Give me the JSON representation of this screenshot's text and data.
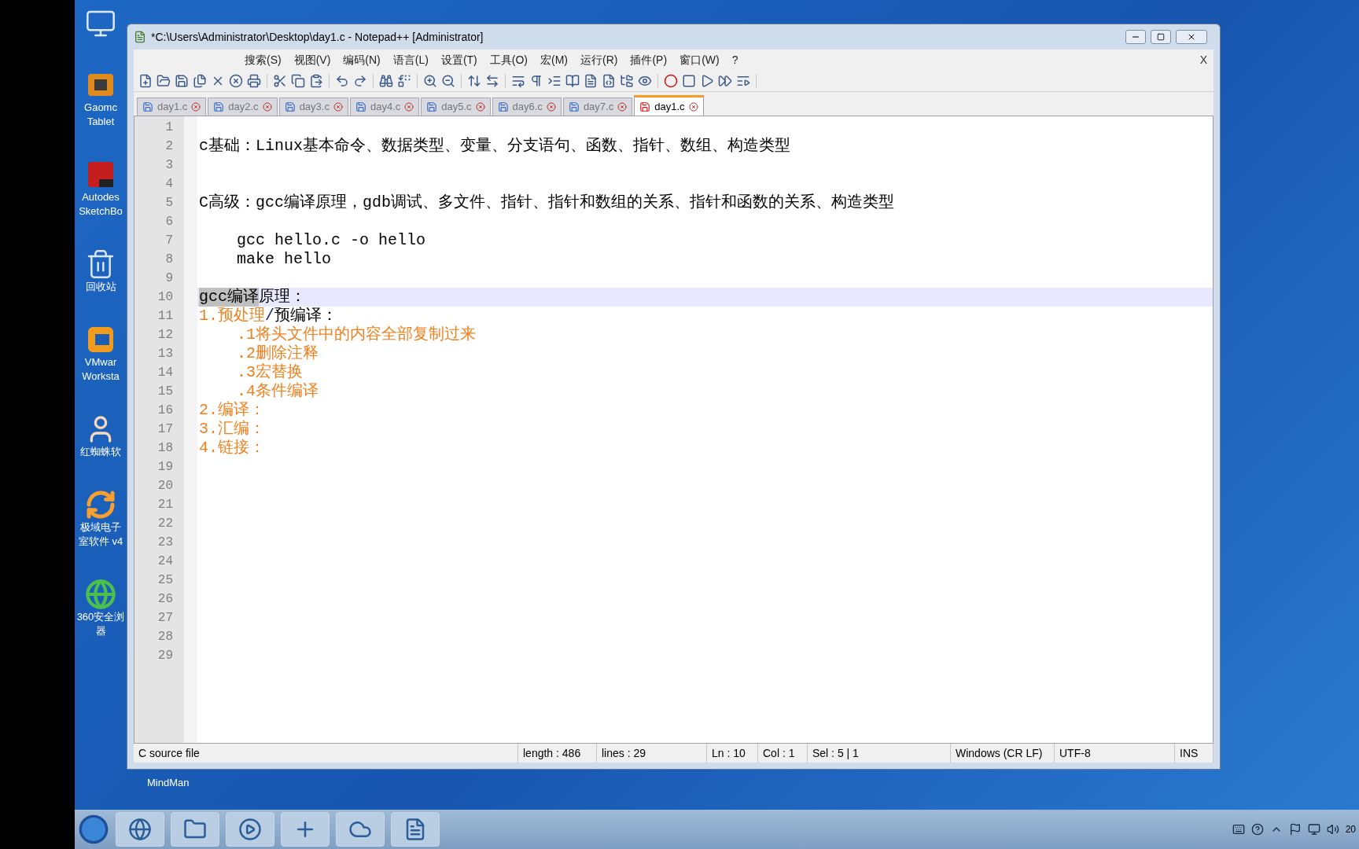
{
  "desktop": {
    "icons": [
      {
        "kind": "computer"
      },
      {
        "kind": "tablet",
        "lines": [
          "Gaomc",
          "Tablet"
        ]
      },
      {
        "kind": "sketch",
        "lines": [
          "Autodes",
          "SketchBo"
        ]
      },
      {
        "kind": "bin",
        "lines": [
          "回收站"
        ]
      },
      {
        "kind": "vm",
        "lines": [
          "VMwar",
          "Worksta"
        ]
      },
      {
        "kind": "person",
        "lines": [
          "红蜘蛛软"
        ]
      },
      {
        "kind": "sync",
        "lines": [
          "极域电子",
          "室软件 v4"
        ]
      },
      {
        "kind": "browser",
        "lines": [
          "360安全浏",
          "器"
        ]
      }
    ],
    "lower_label": "MindMan"
  },
  "window": {
    "title": "*C:\\Users\\Administrator\\Desktop\\day1.c - Notepad++ [Administrator]",
    "menu": [
      "搜索(S)",
      "视图(V)",
      "编码(N)",
      "语言(L)",
      "设置(T)",
      "工具(O)",
      "宏(M)",
      "运行(R)",
      "插件(P)",
      "窗口(W)",
      "?"
    ],
    "close_document": "X",
    "tabs": [
      {
        "label": "day1.c",
        "selected": false,
        "modified": false
      },
      {
        "label": "day2.c",
        "selected": false,
        "modified": false
      },
      {
        "label": "day3.c",
        "selected": false,
        "modified": false
      },
      {
        "label": "day4.c",
        "selected": false,
        "modified": false
      },
      {
        "label": "day5.c",
        "selected": false,
        "modified": false
      },
      {
        "label": "day6.c",
        "selected": false,
        "modified": false
      },
      {
        "label": "day7.c",
        "selected": false,
        "modified": false
      },
      {
        "label": "day1.c",
        "selected": true,
        "modified": true
      }
    ],
    "editor": {
      "lines": [
        {
          "number": "1",
          "current": false
        },
        {
          "number": "2",
          "current": false,
          "segments": [
            {
              "text": "c基础：Linux基本命令、数据类型、变量、分支语句、函数、指针、数组、构造类型",
              "color": "#000000",
              "selected": false
            }
          ]
        },
        {
          "number": "3",
          "current": false
        },
        {
          "number": "4",
          "current": false
        },
        {
          "number": "5",
          "current": false,
          "segments": [
            {
              "text": "C高级：gcc编译原理，gdb调试、多文件、指针、指针和数组的关系、指针和函数的关系、构造类型",
              "color": "#000000",
              "selected": false
            }
          ]
        },
        {
          "number": "6",
          "current": false
        },
        {
          "number": "7",
          "current": false,
          "segments": [
            {
              "text": "    gcc hello.c -o hello",
              "color": "#000000",
              "selected": false
            }
          ]
        },
        {
          "number": "8",
          "current": false,
          "segments": [
            {
              "text": "    make hello",
              "color": "#000000",
              "selected": false
            }
          ]
        },
        {
          "number": "9",
          "current": false
        },
        {
          "number": "10",
          "current": true,
          "segments": [
            {
              "text": "gcc编译",
              "color": "#000000",
              "selected": true
            },
            {
              "text": "原理：",
              "color": "#000000",
              "selected": false
            }
          ]
        },
        {
          "number": "11",
          "current": false,
          "segments": [
            {
              "text": "1.预处理",
              "color": "#f07f1c",
              "selected": false
            },
            {
              "text": "/",
              "color": "#1a237e",
              "selected": false
            },
            {
              "text": "预编译：",
              "color": "#000000",
              "selected": false
            }
          ]
        },
        {
          "number": "12",
          "current": false,
          "segments": [
            {
              "text": "    .1将头文件中的内容全部复制过来",
              "color": "#f07f1c",
              "selected": false
            }
          ]
        },
        {
          "number": "13",
          "current": false,
          "segments": [
            {
              "text": "    .2删除注释",
              "color": "#f07f1c",
              "selected": false
            }
          ]
        },
        {
          "number": "14",
          "current": false,
          "segments": [
            {
              "text": "    .3宏替换",
              "color": "#f07f1c",
              "selected": false
            }
          ]
        },
        {
          "number": "15",
          "current": false,
          "segments": [
            {
              "text": "    .4条件编译",
              "color": "#f07f1c",
              "selected": false
            }
          ]
        },
        {
          "number": "16",
          "current": false,
          "segments": [
            {
              "text": "2.编译：",
              "color": "#f07f1c",
              "selected": false
            }
          ]
        },
        {
          "number": "17",
          "current": false,
          "segments": [
            {
              "text": "3.汇编：",
              "color": "#f07f1c",
              "selected": false
            }
          ]
        },
        {
          "number": "18",
          "current": false,
          "segments": [
            {
              "text": "4.链接：",
              "color": "#f07f1c",
              "selected": false
            }
          ]
        },
        {
          "number": "19",
          "current": false
        },
        {
          "number": "20",
          "current": false
        },
        {
          "number": "21",
          "current": false
        },
        {
          "number": "22",
          "current": false
        },
        {
          "number": "23",
          "current": false
        },
        {
          "number": "24",
          "current": false
        },
        {
          "number": "25",
          "current": false
        },
        {
          "number": "26",
          "current": false
        },
        {
          "number": "27",
          "current": false
        },
        {
          "number": "28",
          "current": false
        },
        {
          "number": "29",
          "current": false
        }
      ]
    },
    "status_bar": [
      "C source file",
      "length : 486",
      "lines : 29",
      "Ln : 10",
      "Col : 1",
      "Sel : 5 | 1",
      "Windows (CR LF)",
      "UTF-8",
      "INS"
    ]
  },
  "taskbar": {
    "clock": "20"
  }
}
